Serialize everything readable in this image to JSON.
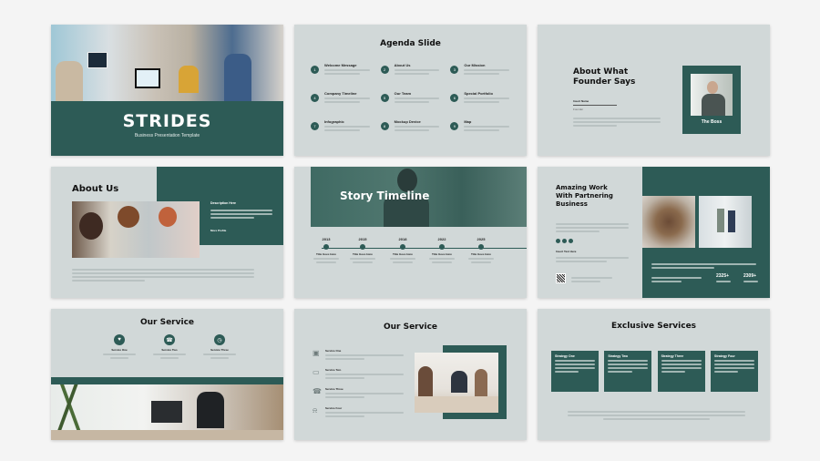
{
  "colors": {
    "accent": "#2d5b56",
    "slide_bg": "#d1d8d8",
    "page_bg": "#f4f4f4"
  },
  "slides": {
    "cover": {
      "title": "STRIDES",
      "subtitle": "Business Presentation Template"
    },
    "agenda": {
      "title": "Agenda Slide",
      "items": [
        {
          "num": "1",
          "label": "Welcome Message"
        },
        {
          "num": "2",
          "label": "About Us"
        },
        {
          "num": "3",
          "label": "Our Mission"
        },
        {
          "num": "4",
          "label": "Company Timeline"
        },
        {
          "num": "5",
          "label": "Our Team"
        },
        {
          "num": "6",
          "label": "Special Portfolio"
        },
        {
          "num": "7",
          "label": "Infographic"
        },
        {
          "num": "8",
          "label": "Mockup Device"
        },
        {
          "num": "9",
          "label": "Map"
        }
      ]
    },
    "founder": {
      "title_line1": "About What",
      "title_line2": "Founder Says",
      "name": "Insert Name",
      "role": "Founder",
      "card_label": "The Boss"
    },
    "about": {
      "title": "About Us",
      "desc_title": "Description Here",
      "footnote_label": "More Profile"
    },
    "timeline": {
      "title": "Story Timeline",
      "events": [
        {
          "year": "2013",
          "title": "Title Goes Here"
        },
        {
          "year": "2015",
          "title": "Title Goes Here"
        },
        {
          "year": "2018",
          "title": "Title Goes Here"
        },
        {
          "year": "2022",
          "title": "Title Goes Here"
        },
        {
          "year": "2025",
          "title": "Title Goes Here"
        }
      ]
    },
    "partner": {
      "title_line1": "Amazing Work",
      "title_line2": "With Partnering",
      "title_line3": "Business",
      "subhead": "Insert Text Here",
      "stats": [
        {
          "value": "2325+"
        },
        {
          "value": "2309+"
        }
      ]
    },
    "service1": {
      "title": "Our Service",
      "items": [
        {
          "label": "Service One"
        },
        {
          "label": "Service Two"
        },
        {
          "label": "Service Three"
        }
      ]
    },
    "service2": {
      "title": "Our Service",
      "items": [
        {
          "label": "Service One"
        },
        {
          "label": "Service Two"
        },
        {
          "label": "Service Three"
        },
        {
          "label": "Service Four"
        }
      ]
    },
    "exclusive": {
      "title": "Exclusive Services",
      "cards": [
        {
          "label": "Strategy One"
        },
        {
          "label": "Strategy Two"
        },
        {
          "label": "Strategy Three"
        },
        {
          "label": "Strategy Four"
        }
      ]
    }
  }
}
